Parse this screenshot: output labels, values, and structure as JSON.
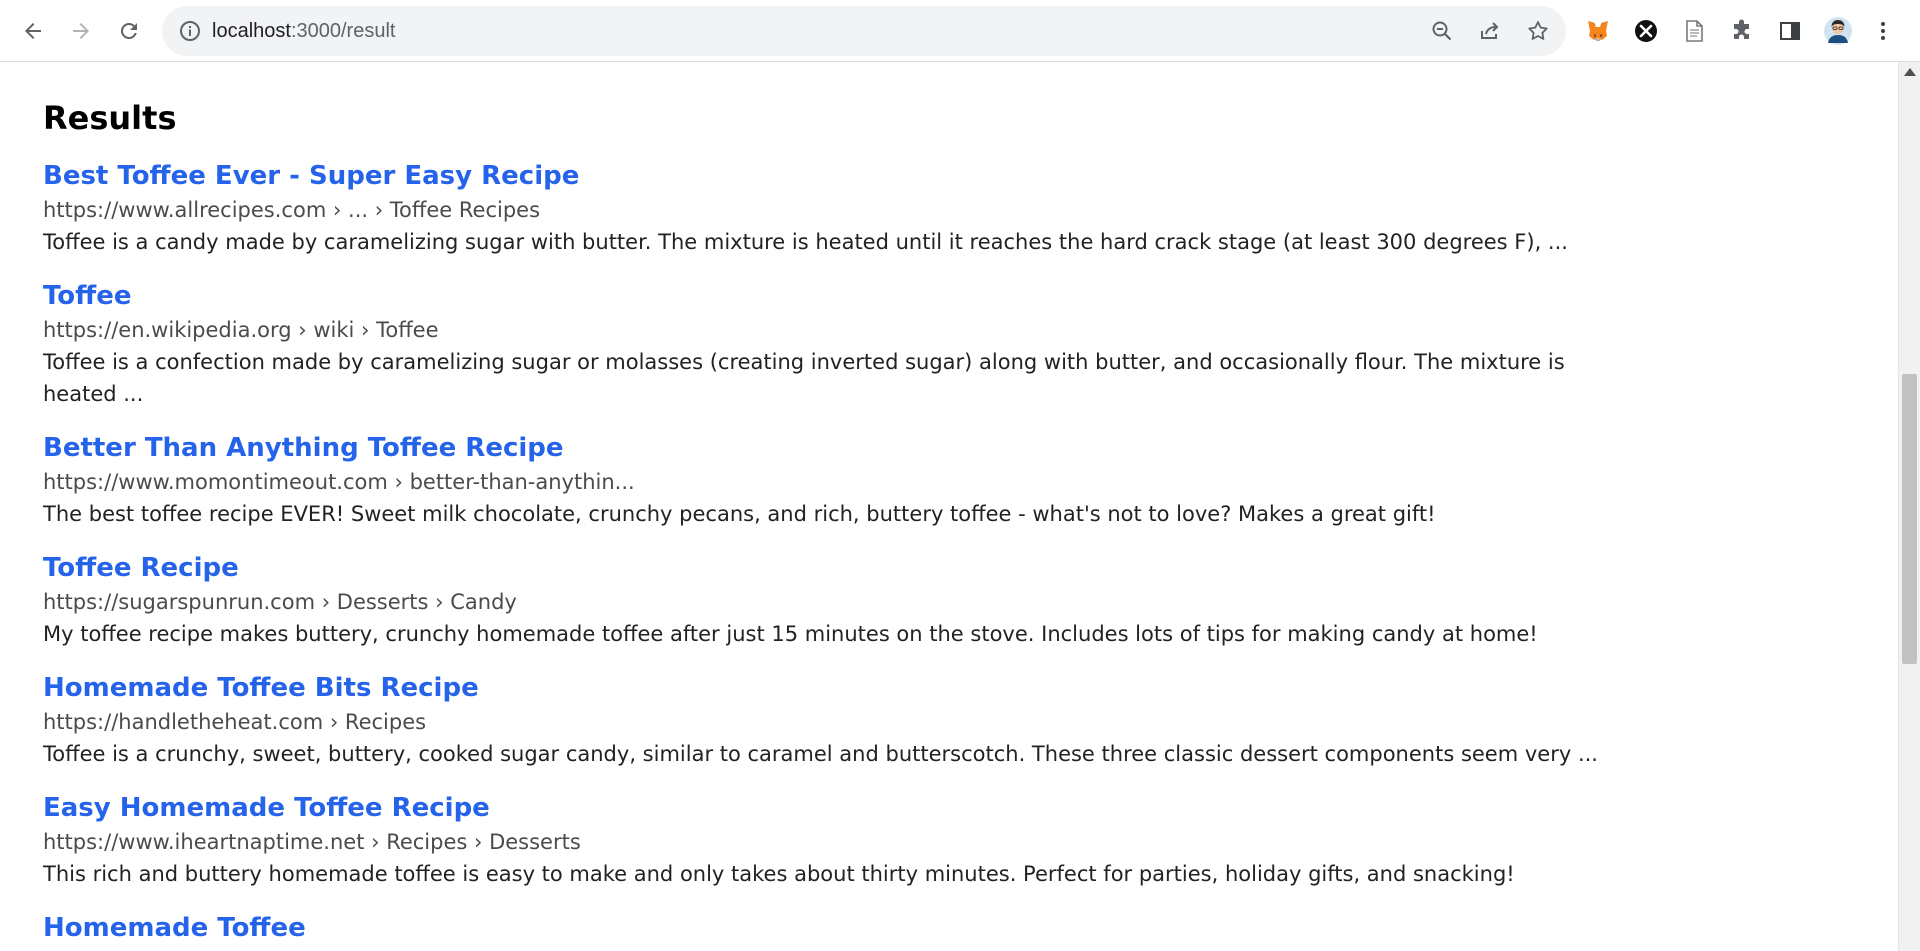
{
  "browser": {
    "url_host": "localhost",
    "url_path": ":3000/result",
    "extensions": [
      "metamask-fox-icon",
      "x-extension-icon",
      "document-extension-icon",
      "puzzle-extensions-icon",
      "side-panel-icon",
      "profile-avatar",
      "more-menu-icon"
    ]
  },
  "page": {
    "heading": "Results",
    "results": [
      {
        "title": "Best Toffee Ever - Super Easy Recipe",
        "url": "https://www.allrecipes.com › ... › Toffee Recipes",
        "snippet": "Toffee is a candy made by caramelizing sugar with butter. The mixture is heated until it reaches the hard crack stage (at least 300 degrees F), ..."
      },
      {
        "title": "Toffee",
        "url": "https://en.wikipedia.org › wiki › Toffee",
        "snippet": "Toffee is a confection made by caramelizing sugar or molasses (creating inverted sugar) along with butter, and occasionally flour. The mixture is heated ..."
      },
      {
        "title": "Better Than Anything Toffee Recipe",
        "url": "https://www.momontimeout.com › better-than-anythin...",
        "snippet": "The best toffee recipe EVER! Sweet milk chocolate, crunchy pecans, and rich, buttery toffee - what's not to love? Makes a great gift!"
      },
      {
        "title": "Toffee Recipe",
        "url": "https://sugarspunrun.com › Desserts › Candy",
        "snippet": "My toffee recipe makes buttery, crunchy homemade toffee after just 15 minutes on the stove. Includes lots of tips for making candy at home!"
      },
      {
        "title": "Homemade Toffee Bits Recipe",
        "url": "https://handletheheat.com › Recipes",
        "snippet": "Toffee is a crunchy, sweet, buttery, cooked sugar candy, similar to caramel and butterscotch. These three classic dessert components seem very ..."
      },
      {
        "title": "Easy Homemade Toffee Recipe",
        "url": "https://www.iheartnaptime.net › Recipes › Desserts",
        "snippet": "This rich and buttery homemade toffee is easy to make and only takes about thirty minutes. Perfect for parties, holiday gifts, and snacking!"
      },
      {
        "title": "Homemade Toffee",
        "url": "",
        "snippet": ""
      }
    ]
  },
  "colors": {
    "link": "#2563eb",
    "url_text": "#4b4b4b",
    "snippet_text": "#222222"
  }
}
